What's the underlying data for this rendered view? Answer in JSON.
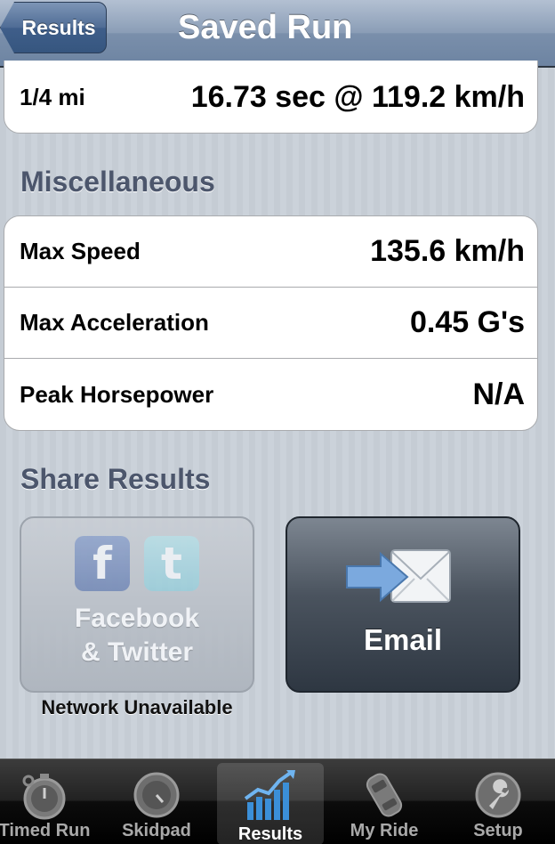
{
  "navbar": {
    "back_label": "Results",
    "title": "Saved Run"
  },
  "top_group": {
    "rows": [
      {
        "label": "1/4 mi",
        "value": "16.73 sec @ 119.2 km/h"
      }
    ]
  },
  "misc": {
    "header": "Miscellaneous",
    "rows": [
      {
        "label": "Max Speed",
        "value": "135.6 km/h"
      },
      {
        "label": "Max Acceleration",
        "value": "0.45 G's"
      },
      {
        "label": "Peak Horsepower",
        "value": "N/A"
      }
    ]
  },
  "share": {
    "header": "Share Results",
    "social": {
      "line1": "Facebook",
      "line2": "& Twitter",
      "fb_glyph": "f",
      "tw_glyph": "t",
      "status": "Network Unavailable"
    },
    "email": {
      "label": "Email"
    }
  },
  "tabbar": {
    "tabs": [
      {
        "label": "Timed Run",
        "icon": "stopwatch-icon",
        "active": false
      },
      {
        "label": "Skidpad",
        "icon": "gauge-icon",
        "active": false
      },
      {
        "label": "Results",
        "icon": "bar-chart-icon",
        "active": true
      },
      {
        "label": "My Ride",
        "icon": "car-icon",
        "active": false
      },
      {
        "label": "Setup",
        "icon": "wrench-icon",
        "active": false
      }
    ]
  },
  "colors": {
    "navbar": "#7a8fab",
    "section_header": "#4c566c",
    "tab_active_icon": "#3b8fd8"
  }
}
